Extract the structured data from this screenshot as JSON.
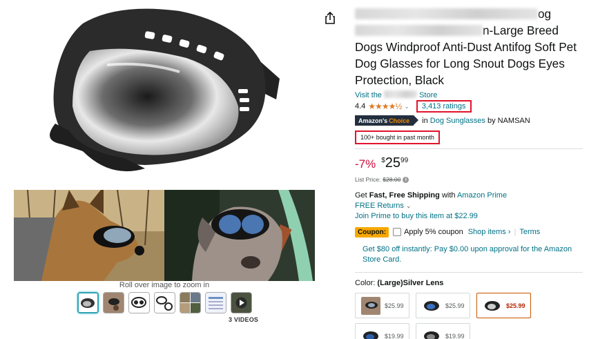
{
  "left": {
    "zoom_hint": "Roll over image to zoom in",
    "videos_label": "3 VIDEOS",
    "thumbnails": [
      "goggles-front",
      "dog-wearing",
      "goggles-outline",
      "goggles-parts",
      "lifestyle",
      "size-chart",
      "video"
    ]
  },
  "product": {
    "title_line1_tail": "og",
    "title_line2_tail": "n-Large Breed",
    "title_rest": "Dogs Windproof Anti-Dust Antifog Soft Pet Dog Glasses for Long Snout Dogs Eyes Protection, Black",
    "store_prefix": "Visit the",
    "store_suffix": "Store",
    "rating_value": "4.4",
    "stars": "★★★★½",
    "ratings_count": "3,413 ratings",
    "choice_amazon": "Amazon's",
    "choice_word": "Choice",
    "choice_in": "in",
    "choice_category": "Dog Sunglasses",
    "choice_by": "by NAMSAN",
    "bought": "100+ bought in past month"
  },
  "price": {
    "discount": "-7%",
    "symbol": "$",
    "whole": "25",
    "fraction": "99",
    "list_label": "List Price:",
    "list_value": "$28.00"
  },
  "shipping": {
    "get": "Get",
    "fast_free": "Fast, Free Shipping",
    "with": "with",
    "prime": "Amazon Prime",
    "returns": "FREE Returns",
    "join": "Join Prime to buy this item at $22.99"
  },
  "coupon": {
    "badge": "Coupon:",
    "apply": "Apply 5% coupon",
    "shop": "Shop items ›",
    "terms": "Terms"
  },
  "card_offer": "Get $80 off instantly: Pay $0.00 upon approval for the Amazon Store Card.",
  "color": {
    "label": "Color:",
    "selected": "(Large)Silver Lens",
    "options": [
      {
        "price": "$25.99",
        "selected": false
      },
      {
        "price": "$25.99",
        "selected": false
      },
      {
        "price": "$25.99",
        "selected": true
      },
      {
        "price": "$19.99",
        "selected": false
      },
      {
        "price": "$19.99",
        "selected": false
      }
    ]
  },
  "colors": {
    "link": "#007185",
    "deal_red": "#cc0c39",
    "highlight_box": "#e0132c",
    "star": "#de7921",
    "coupon_bg": "#f7a800"
  }
}
